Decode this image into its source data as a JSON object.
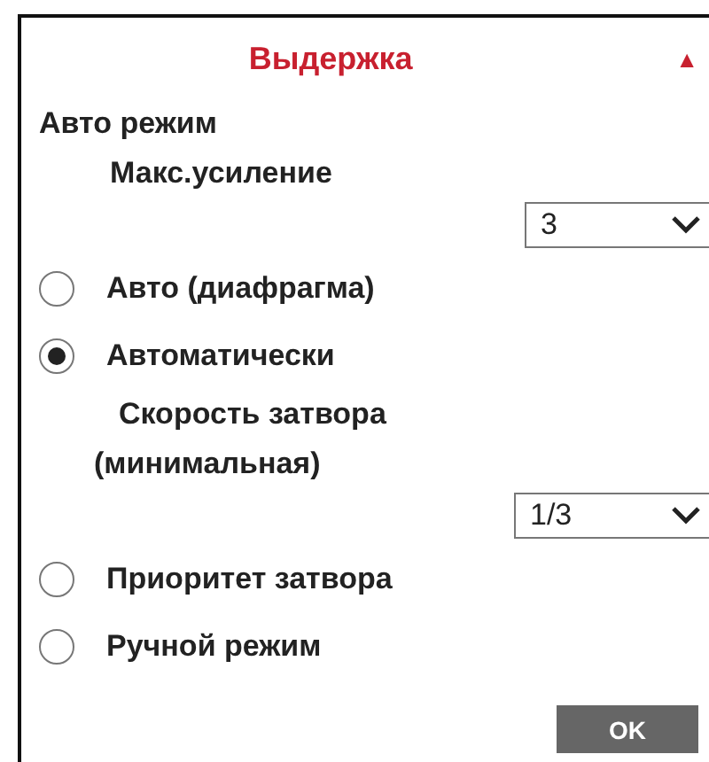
{
  "panel": {
    "title": "Выдержка",
    "collapse_indicator": "▲"
  },
  "auto_mode": {
    "label": "Авто режим"
  },
  "max_gain": {
    "label": "Макс.усиление",
    "value": "3"
  },
  "exposure_modes": [
    {
      "label": "Авто (диафрагма)",
      "selected": false
    },
    {
      "label": "Автоматически",
      "selected": true
    },
    {
      "label": "Приоритет затвора",
      "selected": false
    },
    {
      "label": "Ручной режим",
      "selected": false
    }
  ],
  "shutter_speed": {
    "label_lines": [
      "Скорость затвора",
      "(минимальная)"
    ],
    "value": "1/3"
  },
  "buttons": [
    "OK"
  ]
}
